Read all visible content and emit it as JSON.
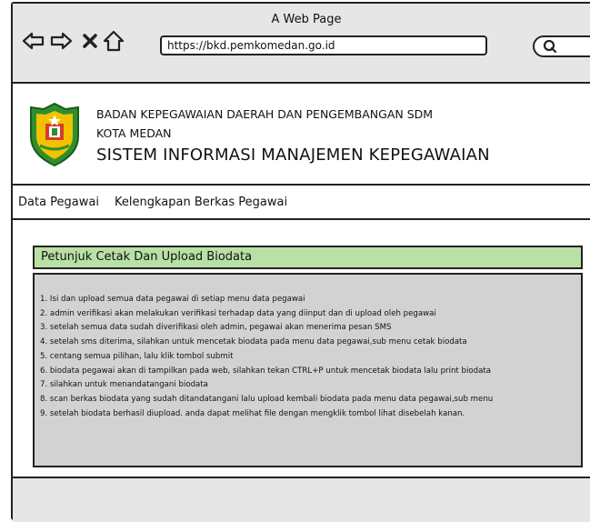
{
  "window": {
    "title": "A Web Page"
  },
  "browser": {
    "url": "https://bkd.pemkomedan.go.id",
    "back_icon": "back-arrow-icon",
    "forward_icon": "forward-arrow-icon",
    "close_icon": "close-icon",
    "home_icon": "home-icon",
    "search_icon": "search-icon"
  },
  "header": {
    "org_line1": "BADAN KEPEGAWAIAN DAERAH DAN PENGEMBANGAN SDM",
    "org_line2": "KOTA MEDAN",
    "system_name": "SISTEM INFORMASI MANAJEMEN KEPEGAWAIAN",
    "logo_icon": "kota-medan-emblem",
    "colors": {
      "logo_green": "#2f8f2f",
      "logo_yellow": "#f2c200",
      "logo_red": "#d83a2a"
    }
  },
  "menu": {
    "items": [
      "Data Pegawai",
      "Kelengkapan Berkas Pegawai"
    ]
  },
  "panel": {
    "title": "Petunjuk Cetak Dan Upload Biodata",
    "title_bg": "#b9e0a5",
    "body_bg": "#d2d2d2",
    "items": [
      "1. Isi dan upload semua data pegawai di setiap menu data pegawai",
      "2. admin verifikasi akan melakukan verifikasi terhadap data yang diinput dan di upload oleh pegawai",
      "3. setelah semua data sudah diverifikasi oleh admin, pegawai akan menerima pesan SMS",
      "4. setelah sms diterima, silahkan untuk mencetak biodata pada menu data pegawai,sub menu cetak biodata",
      "5. centang semua pilihan, lalu klik tombol submit",
      "6. biodata pegawai akan di tampilkan pada web, silahkan tekan CTRL+P untuk mencetak biodata lalu print biodata",
      "7. silahkan untuk menandatangani biodata",
      "8. scan berkas biodata yang sudah ditandatangani lalu upload kembali biodata pada menu data pegawai,sub menu",
      "9. setelah biodata berhasil diupload. anda dapat melihat file dengan mengklik tombol lihat disebelah kanan."
    ]
  }
}
